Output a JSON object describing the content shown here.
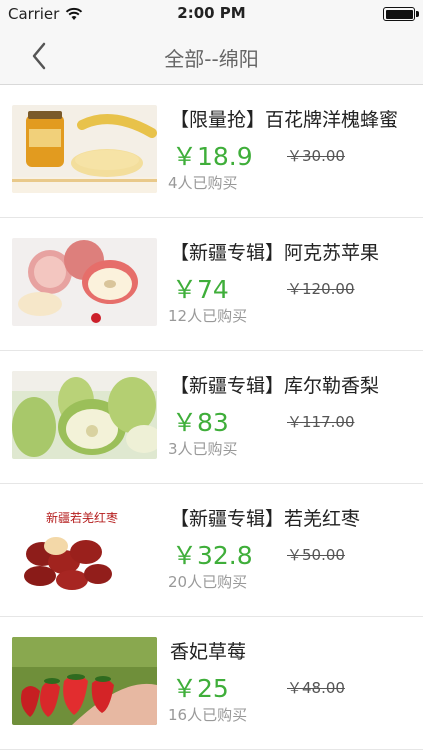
{
  "status": {
    "carrier": "Carrier",
    "time": "2:00 PM"
  },
  "nav": {
    "title": "全部--绵阳",
    "back_icon": "chevron-left-icon"
  },
  "products": [
    {
      "title": "【限量抢】百花牌洋槐蜂蜜",
      "price": "￥18.9",
      "old_price": "￥30.00",
      "sold": "4人已购买",
      "image": "honey-jar"
    },
    {
      "title": "【新疆专辑】阿克苏苹果",
      "price": "￥74",
      "old_price": "￥120.00",
      "sold": "12人已购买",
      "image": "apples"
    },
    {
      "title": "【新疆专辑】库尔勒香梨",
      "price": "￥83",
      "old_price": "￥117.00",
      "sold": "3人已购买",
      "image": "pears"
    },
    {
      "title": "【新疆专辑】若羌红枣",
      "price": "￥32.8",
      "old_price": "￥50.00",
      "sold": "20人已购买",
      "image": "red-dates",
      "image_label": "新疆若羌红枣"
    },
    {
      "title": "香妃草莓",
      "price": "￥25",
      "old_price": "￥48.00",
      "sold": "16人已购买",
      "image": "strawberries"
    }
  ],
  "colors": {
    "price": "#3fae3a",
    "nav_bg": "#f7f7f7"
  }
}
